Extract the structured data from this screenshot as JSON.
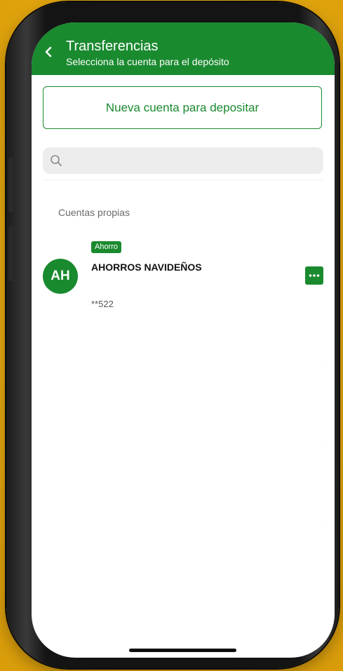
{
  "header": {
    "title": "Transferencias",
    "subtitle": "Selecciona la cuenta para el depósito",
    "back_icon": "chevron-left-icon"
  },
  "new_account": {
    "label": "Nueva cuenta para depositar"
  },
  "search": {
    "placeholder": "",
    "value": "",
    "icon": "search-icon"
  },
  "section": {
    "title": "Cuentas propias"
  },
  "accounts": [
    {
      "initials": "AH",
      "type": "Ahorro",
      "name": "AHORROS NAVIDEÑOS",
      "number": "**522",
      "menu_icon": "more-horizontal-icon"
    }
  ],
  "colors": {
    "primary_green": "#1a8a2f",
    "background_yellow": "#f0b619",
    "search_bg": "#ededed"
  }
}
